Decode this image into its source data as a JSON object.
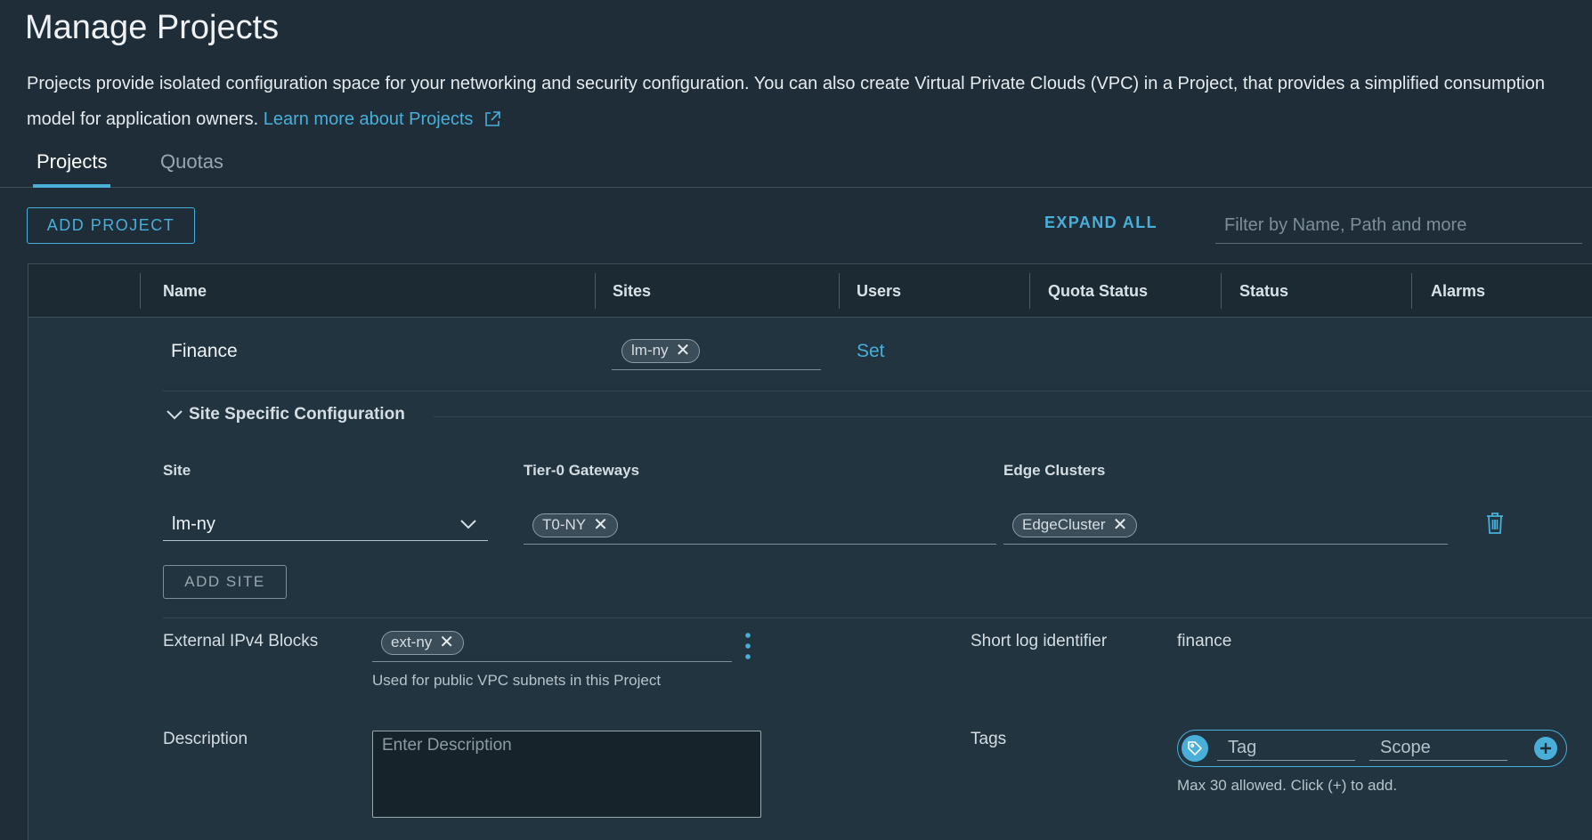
{
  "page": {
    "title": "Manage Projects",
    "description": "Projects provide isolated configuration space for your networking and security configuration. You can also create Virtual Private Clouds (VPC) in a Project, that provides a simplified consumption model for application owners.",
    "learn_more": "Learn more about Projects"
  },
  "tabs": [
    {
      "label": "Projects",
      "active": true
    },
    {
      "label": "Quotas",
      "active": false
    }
  ],
  "toolbar": {
    "add_project": "ADD PROJECT",
    "expand_all": "EXPAND ALL",
    "filter_placeholder": "Filter by Name, Path and more"
  },
  "table": {
    "columns": [
      "Name",
      "Sites",
      "Users",
      "Quota Status",
      "Status",
      "Alarms"
    ]
  },
  "project": {
    "name": "Finance",
    "sites": [
      "lm-ny"
    ],
    "users_link": "Set",
    "site_config": {
      "title": "Site Specific Configuration",
      "site_label": "Site",
      "tier0_label": "Tier-0 Gateways",
      "edge_label": "Edge Clusters",
      "site_value": "lm-ny",
      "tier0_value": "T0-NY",
      "edge_value": "EdgeCluster",
      "add_site": "ADD SITE"
    },
    "ipv4": {
      "label": "External IPv4 Blocks",
      "value": "ext-ny",
      "help": "Used for public VPC subnets in this Project"
    },
    "log": {
      "label": "Short log identifier",
      "value": "finance"
    },
    "description": {
      "label": "Description",
      "placeholder": "Enter Description"
    },
    "tags": {
      "label": "Tags",
      "tag_placeholder": "Tag",
      "scope_placeholder": "Scope",
      "help": "Max 30 allowed. Click (+) to add."
    }
  },
  "colors": {
    "background": "#1e2d38",
    "accent": "#49afd9",
    "header": "#1b2a33"
  },
  "icons": [
    "external-link-icon",
    "chevron-down-icon",
    "close-icon",
    "trash-icon",
    "kebab-icon",
    "tag-icon",
    "plus-icon"
  ]
}
